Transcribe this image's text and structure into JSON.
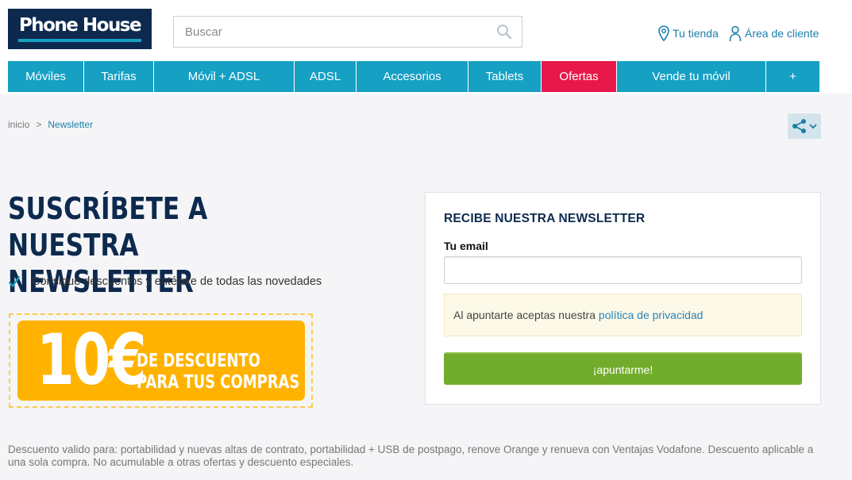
{
  "header": {
    "logo_text": "Phone House",
    "search_placeholder": "Buscar",
    "tienda": "Tu tienda",
    "cliente": "Área de cliente"
  },
  "nav": {
    "items": [
      "Móviles",
      "Tarifas",
      "Móvil + ADSL",
      "ADSL",
      "Accesorios",
      "Tablets",
      "Ofertas",
      "Vende tu móvil",
      "+"
    ]
  },
  "breadcrumb": {
    "home": "inicio",
    "sep": ">",
    "current": "Newsletter"
  },
  "main": {
    "title_line1": "SUSCRÍBETE A NUESTRA",
    "title_line2": "NEWSLETTER",
    "benefit": "Consigue descuentos y entérate de todas las novedades",
    "promo_amount": "10€",
    "promo_line1": "DE DESCUENTO",
    "promo_line2": "PARA TUS COMPRAS"
  },
  "form": {
    "title": "RECIBE NUESTRA NEWSLETTER",
    "email_label": "Tu email",
    "email_value": "",
    "privacy_text": "Al apuntarte aceptas nuestra ",
    "privacy_link": "política de privacidad",
    "submit": "¡apuntarme!"
  },
  "footer": {
    "disclaimer": "Descuento valido para: portabilidad y nuevas altas de contrato, portabilidad + USB de postpago, renove Orange y renueva con Ventajas Vodafone. Descuento aplicable a una sola compra. No acumulable a otras ofertas y descuento especiales."
  },
  "colors": {
    "brand_navy": "#0d2a4e",
    "nav_teal": "#15a0c4",
    "ofertas_red": "#e8194a",
    "promo_orange": "#ffb300",
    "submit_green": "#72ac2c"
  },
  "icons": [
    "search-icon",
    "location-pin-icon",
    "user-icon",
    "share-icon",
    "chevron-down-icon",
    "checkmark-icon"
  ]
}
